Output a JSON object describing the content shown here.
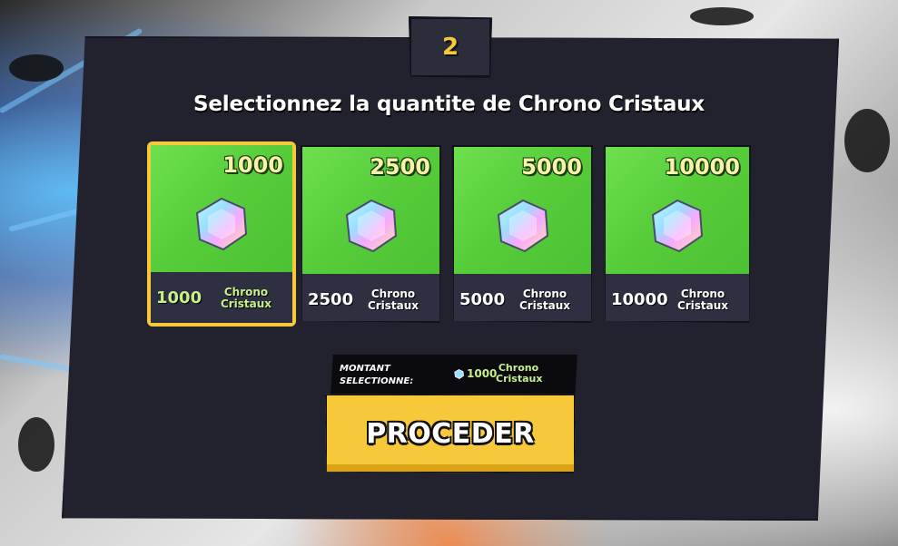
{
  "step": "2",
  "title": "Selectionnez la quantite de Chrono Cristaux",
  "unit_label": "Chrono Cristaux",
  "options": [
    {
      "top_amount": "1000",
      "quantity": "1000",
      "unit": "Chrono Cristaux",
      "selected": true
    },
    {
      "top_amount": "2500",
      "quantity": "2500",
      "unit": "Chrono Cristaux",
      "selected": false
    },
    {
      "top_amount": "5000",
      "quantity": "5000",
      "unit": "Chrono Cristaux",
      "selected": false
    },
    {
      "top_amount": "10000",
      "quantity": "10000",
      "unit": "Chrono Cristaux",
      "selected": false
    }
  ],
  "summary": {
    "label": "MONTANT SELECTIONNE:",
    "amount": "1000",
    "unit": "Chrono Cristaux",
    "icon": "crystal-icon"
  },
  "proceed_label": "PROCEDER",
  "colors": {
    "accent_yellow": "#f6c83a",
    "card_green": "#56cc3a",
    "panel_dark": "#21222e",
    "highlight_green": "#c6f08a"
  }
}
